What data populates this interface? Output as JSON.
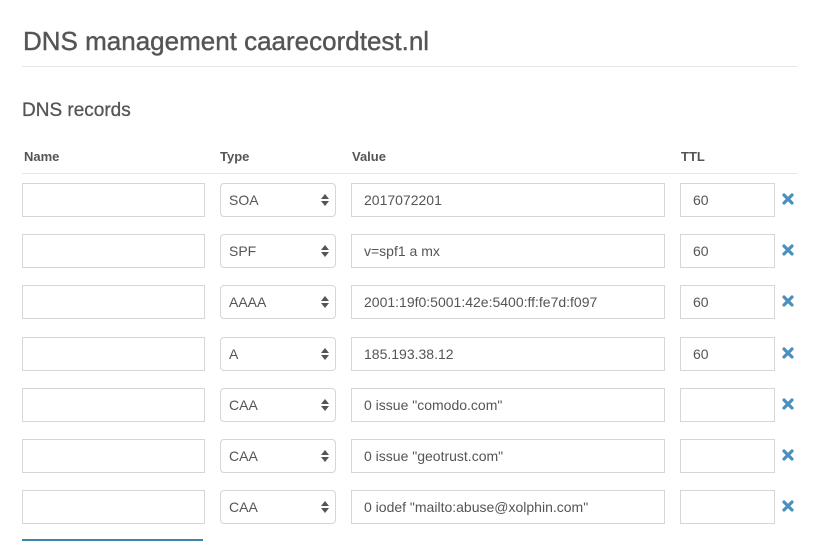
{
  "page": {
    "title": "DNS management caarecordtest.nl",
    "section_title": "DNS records"
  },
  "table": {
    "headers": {
      "name": "Name",
      "type": "Type",
      "value": "Value",
      "ttl": "TTL"
    },
    "rows": [
      {
        "name": "",
        "type": "SOA",
        "value": "2017072201",
        "ttl": "60"
      },
      {
        "name": "",
        "type": "SPF",
        "value": "v=spf1 a mx",
        "ttl": "60"
      },
      {
        "name": "",
        "type": "AAAA",
        "value": "2001:19f0:5001:42e:5400:ff:fe7d:f097",
        "ttl": "60"
      },
      {
        "name": "",
        "type": "A",
        "value": "185.193.38.12",
        "ttl": "60"
      },
      {
        "name": "",
        "type": "CAA",
        "value": "0 issue \"comodo.com\"",
        "ttl": ""
      },
      {
        "name": "",
        "type": "CAA",
        "value": "0 issue \"geotrust.com\"",
        "ttl": ""
      },
      {
        "name": "",
        "type": "CAA",
        "value": "0 iodef \"mailto:abuse@xolphin.com\"",
        "ttl": ""
      }
    ],
    "delete_icon": "close-icon"
  },
  "colors": {
    "accent": "#4a90bf",
    "text": "#555555",
    "border": "#d6d6d6"
  }
}
